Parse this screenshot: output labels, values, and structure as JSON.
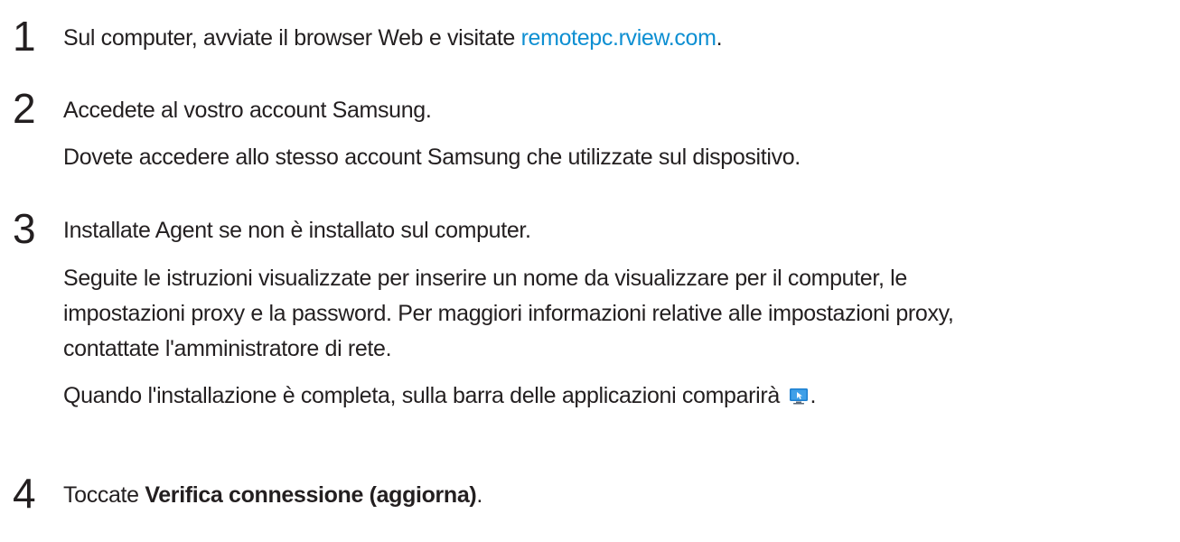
{
  "steps": [
    {
      "number": "1",
      "text_before": "Sul computer, avviate il browser Web e visitate ",
      "link": "remotepc.rview.com",
      "text_after": "."
    },
    {
      "number": "2",
      "main": "Accedete al vostro account Samsung.",
      "note": "Dovete accedere allo stesso account Samsung che utilizzate sul dispositivo."
    },
    {
      "number": "3",
      "main": "Installate Agent se non è installato sul computer.",
      "note_line1": "Seguite le istruzioni visualizzate per inserire un nome da visualizzare per il computer, le",
      "note_line2": "impostazioni proxy e la password. Per maggiori informazioni relative alle impostazioni proxy,",
      "note_line3": "contattate l'amministratore di rete.",
      "note2_before": "Quando l'installazione è completa, sulla barra delle applicazioni comparirà ",
      "note2_icon": "remote-pc-agent-icon",
      "note2_after": "."
    },
    {
      "number": "4",
      "text_before": "Toccate ",
      "bold": "Verifica connessione (aggiorna)",
      "text_after": "."
    }
  ],
  "colors": {
    "text": "#231f20",
    "link": "#0e8fd2",
    "icon_blue": "#1c7fd0"
  }
}
